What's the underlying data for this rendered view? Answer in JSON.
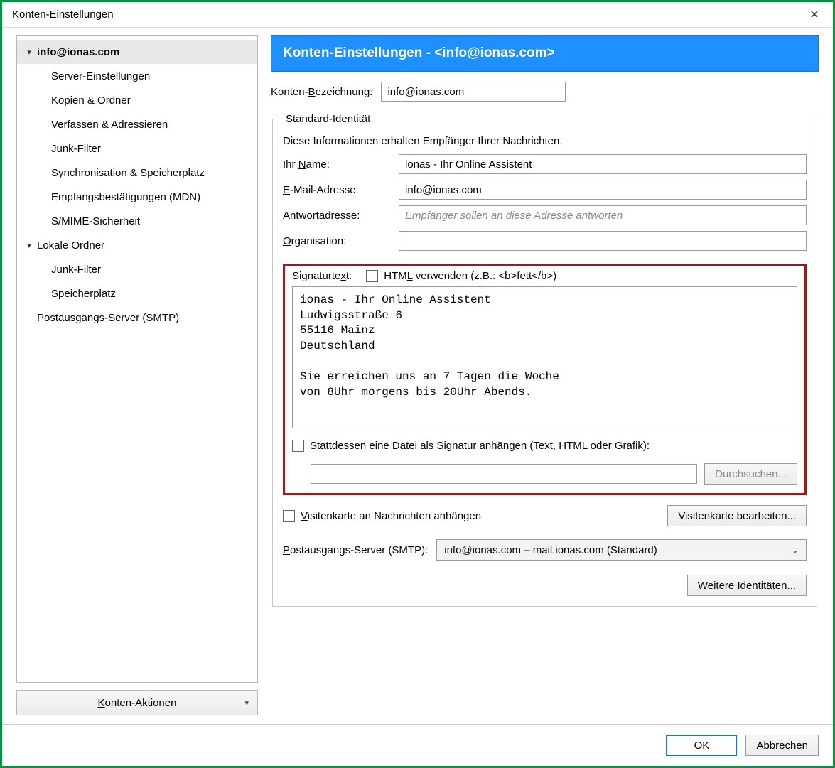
{
  "window": {
    "title": "Konten-Einstellungen"
  },
  "sidebar": {
    "items": [
      {
        "label": "info@ionas.com",
        "level": 0,
        "expander": "▾",
        "selected": true
      },
      {
        "label": "Server-Einstellungen",
        "level": 1
      },
      {
        "label": "Kopien & Ordner",
        "level": 1
      },
      {
        "label": "Verfassen & Adressieren",
        "level": 1
      },
      {
        "label": "Junk-Filter",
        "level": 1
      },
      {
        "label": "Synchronisation & Speicherplatz",
        "level": 1
      },
      {
        "label": "Empfangsbestätigungen (MDN)",
        "level": 1
      },
      {
        "label": "S/MIME-Sicherheit",
        "level": 1
      },
      {
        "label": "Lokale Ordner",
        "level": 0,
        "expander": "▾"
      },
      {
        "label": "Junk-Filter",
        "level": 1
      },
      {
        "label": "Speicherplatz",
        "level": 1
      },
      {
        "label": "Postausgangs-Server (SMTP)",
        "level": 0,
        "expander": ""
      }
    ],
    "actions_label": "Konten-Aktionen"
  },
  "main": {
    "banner": "Konten-Einstellungen -  <info@ionas.com>",
    "account_name_label": "Konten-Bezeichnung:",
    "account_name_value": "info@ionas.com",
    "identity": {
      "legend": "Standard-Identität",
      "desc": "Diese Informationen erhalten Empfänger Ihrer Nachrichten.",
      "name_label": "Ihr Name:",
      "name_value": "ionas - Ihr Online Assistent",
      "email_label": "E-Mail-Adresse:",
      "email_value": "info@ionas.com",
      "reply_label": "Antwortadresse:",
      "reply_placeholder": "Empfänger sollen an diese Adresse antworten",
      "reply_value": "",
      "org_label": "Organisation:",
      "org_value": ""
    },
    "signature": {
      "label": "Signaturtext:",
      "use_html_label": "HTML verwenden (z.B.: <b>fett</b>)",
      "use_html_checked": false,
      "text": "ionas - Ihr Online Assistent\nLudwigsstraße 6\n55116 Mainz\nDeutschland\n\nSie erreichen uns an 7 Tagen die Woche\nvon 8Uhr morgens bis 20Uhr Abends.",
      "attach_file_label": "Stattdessen eine Datei als Signatur anhängen (Text, HTML oder Grafik):",
      "attach_file_checked": false,
      "file_path": "",
      "browse_label": "Durchsuchen..."
    },
    "vcard": {
      "attach_label": "Visitenkarte an Nachrichten anhängen",
      "attach_checked": false,
      "edit_label": "Visitenkarte bearbeiten..."
    },
    "smtp": {
      "label": "Postausgangs-Server (SMTP):",
      "selected": "info@ionas.com – mail.ionas.com (Standard)"
    },
    "more_identities_label": "Weitere Identitäten..."
  },
  "footer": {
    "ok": "OK",
    "cancel": "Abbrechen"
  }
}
